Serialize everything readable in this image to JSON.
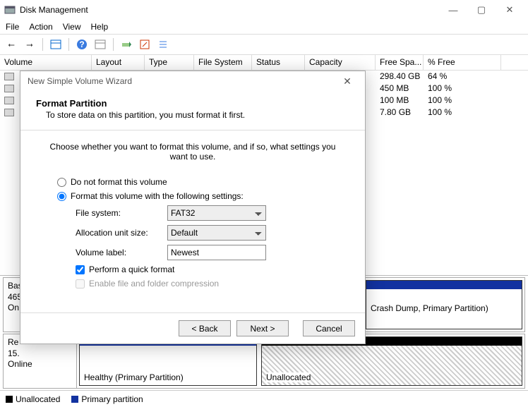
{
  "window": {
    "title": "Disk Management"
  },
  "menu": {
    "file": "File",
    "action": "Action",
    "view": "View",
    "help": "Help"
  },
  "columns": {
    "volume": "Volume",
    "layout": "Layout",
    "type": "Type",
    "fs": "File System",
    "status": "Status",
    "capacity": "Capacity",
    "free": "Free Spa...",
    "pct": "% Free"
  },
  "rows_visible": [
    {
      "free": "298.40 GB",
      "pct": "64 %"
    },
    {
      "free": "450 MB",
      "pct": "100 %"
    },
    {
      "free": "100 MB",
      "pct": "100 %"
    },
    {
      "free": "7.80 GB",
      "pct": "100 %"
    }
  ],
  "disk0": {
    "name": "Bas",
    "size": "465",
    "status": "On"
  },
  "disk1": {
    "name": "Re",
    "size": "15.",
    "status": "Online",
    "part_status": "Healthy (Primary Partition)",
    "unalloc": "Unallocated",
    "right_text": "Crash Dump, Primary Partition)"
  },
  "legend": {
    "unalloc": "Unallocated",
    "primary": "Primary partition"
  },
  "wizard": {
    "title": "New Simple Volume Wizard",
    "heading": "Format Partition",
    "sub": "To store data on this partition, you must format it first.",
    "intro": "Choose whether you want to format this volume, and if so, what settings you want to use.",
    "opt_noformat": "Do not format this volume",
    "opt_format": "Format this volume with the following settings:",
    "fs_label": "File system:",
    "fs_value": "FAT32",
    "alloc_label": "Allocation unit size:",
    "alloc_value": "Default",
    "vol_label": "Volume label:",
    "vol_value": "Newest",
    "quick": "Perform a quick format",
    "compress": "Enable file and folder compression",
    "back": "< Back",
    "next": "Next >",
    "cancel": "Cancel"
  }
}
